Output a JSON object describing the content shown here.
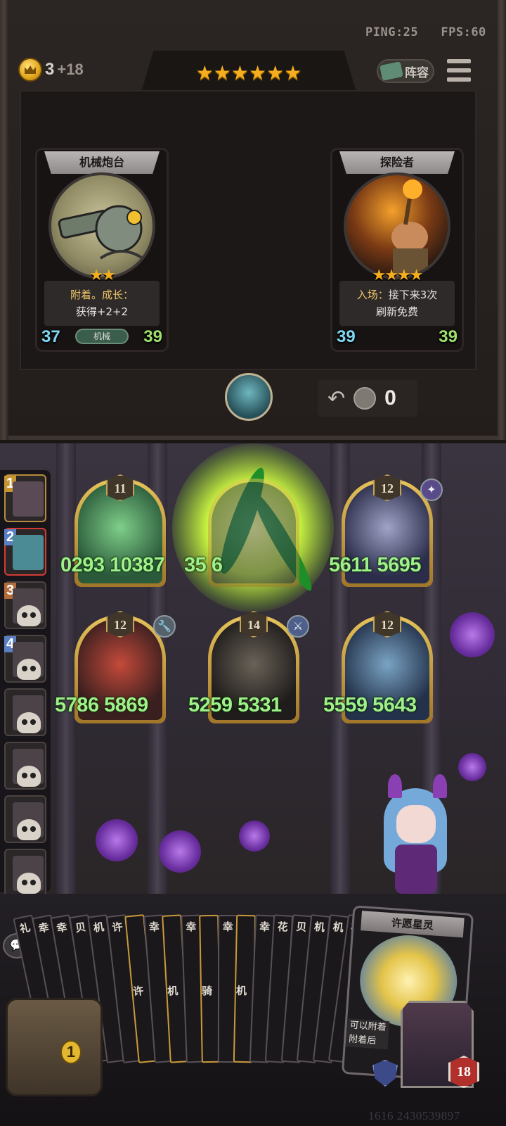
{
  "hud": {
    "ping": "PING:25",
    "fps": "FPS:60",
    "gold": "3",
    "gold_income": "+18",
    "lineup_label": "阵容",
    "tier_stars": "★★★★★★"
  },
  "shop": {
    "cards": [
      {
        "title": "机械炮台",
        "stars": "★★",
        "desc_keyword": "附着。成长：",
        "desc": "获得+2+2",
        "attack": "37",
        "health": "39",
        "tag": "机械"
      },
      {
        "title": "探险者",
        "stars": "★★★★",
        "desc_keyword": "入场：",
        "desc_a": "接下来3次",
        "desc": "刷新免费",
        "attack": "39",
        "health": "39"
      }
    ],
    "refresh_cost": "0"
  },
  "seats": [
    "1",
    "2",
    "3",
    "4"
  ],
  "board": {
    "units": [
      {
        "level": "11",
        "stats": "0293 10387"
      },
      {
        "level": "",
        "stats": "35 6"
      },
      {
        "level": "12",
        "stats": "5611 5695"
      },
      {
        "level": "12",
        "stats": "5786 5869"
      },
      {
        "level": "14",
        "stats": "5259 5331"
      },
      {
        "level": "12",
        "stats": "5559 5643"
      }
    ]
  },
  "hand": {
    "cards": [
      "礼",
      "幸",
      "幸",
      "贝",
      "机",
      "许",
      "许",
      "幸",
      "机",
      "幸",
      "骑",
      "幸",
      "机",
      "幸",
      "花",
      "贝",
      "机",
      "机",
      "机"
    ],
    "featured": {
      "title": "许愿星灵",
      "text_a": "可以附着",
      "text_b": "附着后"
    }
  },
  "player": {
    "health": "18",
    "chest_count": "1"
  },
  "footer": "1616 2430539897",
  "colors": {
    "accent": "#f6ae1e",
    "stats": "#9ff08a",
    "active_seat": "#d33b34"
  }
}
